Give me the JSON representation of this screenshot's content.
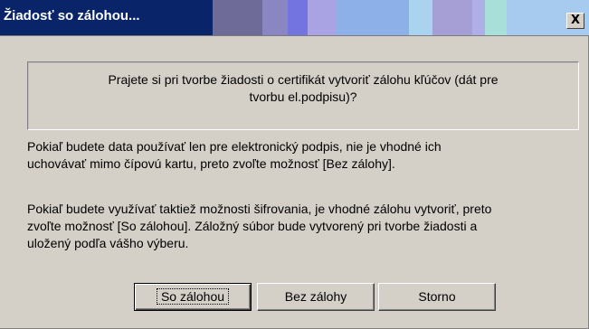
{
  "window": {
    "title": "Žiadosť so zálohou...",
    "close_label": "X"
  },
  "question": {
    "line1": "Prajete si pri tvorbe žiadosti o certifikát vytvoriť zálohu kľúčov (dát pre",
    "line2": "tvorbu el.podpisu)?"
  },
  "info1": {
    "line1": "Pokiaľ budete data používať len pre elektronický podpis, nie je vhodné ich",
    "line2": "uchovávať mimo čípovú kartu, preto zvoľte možnosť [Bez zálohy]."
  },
  "info2": {
    "line1": "Pokiaľ budete využívať taktiež možnosti šifrovania, je vhodné zálohu vytvoriť, preto",
    "line2": "zvoľte možnosť [So zálohou]. Záložný súbor bude vytvorený pri tvorbe žiadosti a",
    "line3": "uložený podľa vášho výberu."
  },
  "buttons": {
    "save": "So zálohou",
    "no_backup": "Bez zálohy",
    "cancel": "Storno"
  },
  "colors": {
    "titlebar_active": "#0a246a",
    "dialog_face": "#d4d0c8"
  }
}
